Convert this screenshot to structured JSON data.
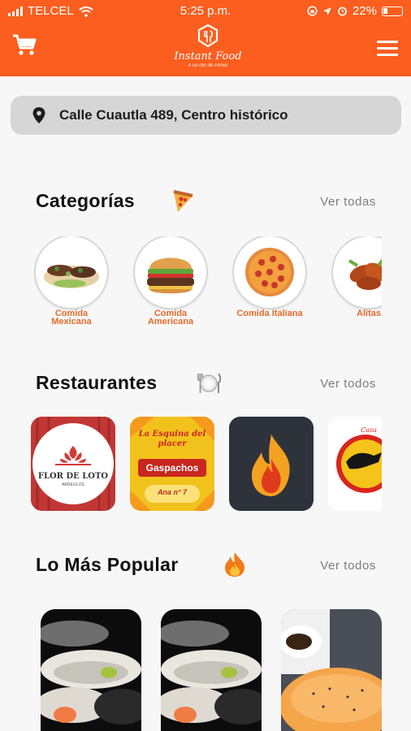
{
  "status": {
    "carrier": "TELCEL",
    "time": "5:25 p.m.",
    "battery": "22%"
  },
  "header": {
    "brand": "Instant Food",
    "tagline": "A un clic de comer"
  },
  "address": {
    "text": "Calle Cuautla 489, Centro histórico",
    "icon": "location-pin-icon"
  },
  "categories": {
    "title": "Categorías",
    "see_all": "Ver todas",
    "items": [
      {
        "label": "Comida Mexicana",
        "icon": "tacos-icon"
      },
      {
        "label": "Comida Americana",
        "icon": "burger-icon"
      },
      {
        "label": "Comida Italiana",
        "icon": "pizza-icon"
      },
      {
        "label": "Alitas",
        "icon": "wings-icon"
      }
    ]
  },
  "restaurants": {
    "title": "Restaurantes",
    "see_all": "Ver todos",
    "items": [
      {
        "name": "FLOR DE LOTO",
        "sub": "ARREGLOS",
        "bg": "#c93c3a"
      },
      {
        "name": "La Esquina del placer",
        "sub": "Gaspachos",
        "note": "Ana n° 7",
        "bg": "#f6c71d"
      },
      {
        "name": "",
        "bg": "#2e323b"
      },
      {
        "name": "Casa",
        "bg": "#ffffff"
      }
    ]
  },
  "popular": {
    "title": "Lo Más Popular",
    "see_all": "Ver todos"
  },
  "colors": {
    "brand": "#fb5e1f",
    "category_label": "#e66b2a"
  }
}
